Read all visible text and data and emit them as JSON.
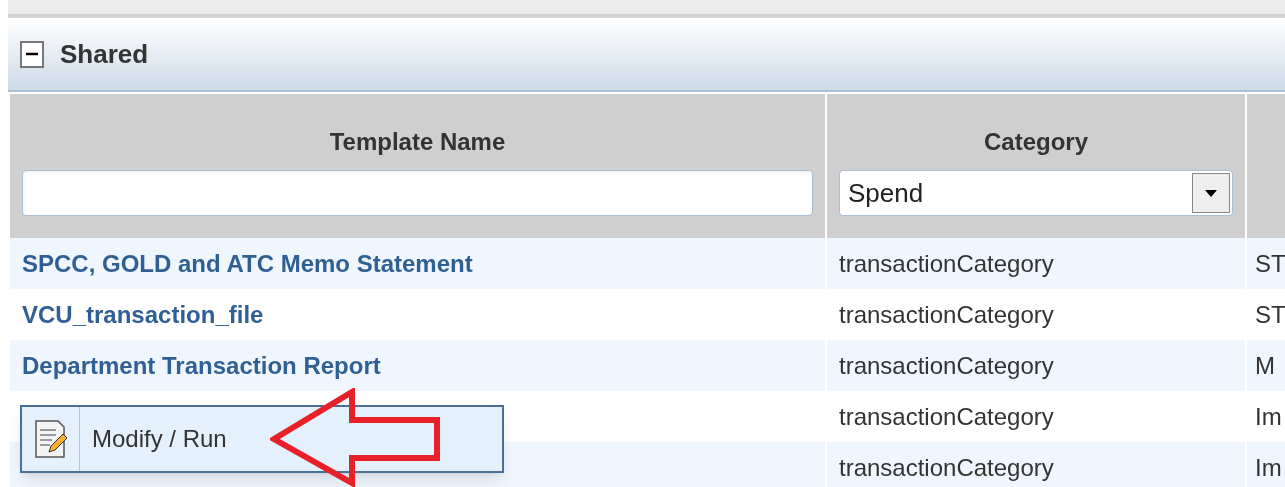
{
  "panel": {
    "title": "Shared",
    "expanded": true
  },
  "table": {
    "columns": [
      {
        "label": "Template Name",
        "kind": "text"
      },
      {
        "label": "Category",
        "kind": "select",
        "filter_value": "Spend"
      }
    ],
    "rows": [
      {
        "name": "SPCC, GOLD and ATC Memo Statement",
        "category": "transactionCategory",
        "column_3": "ST"
      },
      {
        "name": "VCU_transaction_file",
        "category": "transactionCategory",
        "column_3": "ST"
      },
      {
        "name": "Department Transaction Report",
        "category": "transactionCategory",
        "column_3": "M"
      },
      {
        "category": "transactionCategory",
        "column_3": "Im"
      },
      {
        "category": "transactionCategory",
        "column_3": "Im"
      }
    ]
  },
  "context_menu": {
    "items": [
      {
        "label": "Modify / Run"
      }
    ]
  }
}
